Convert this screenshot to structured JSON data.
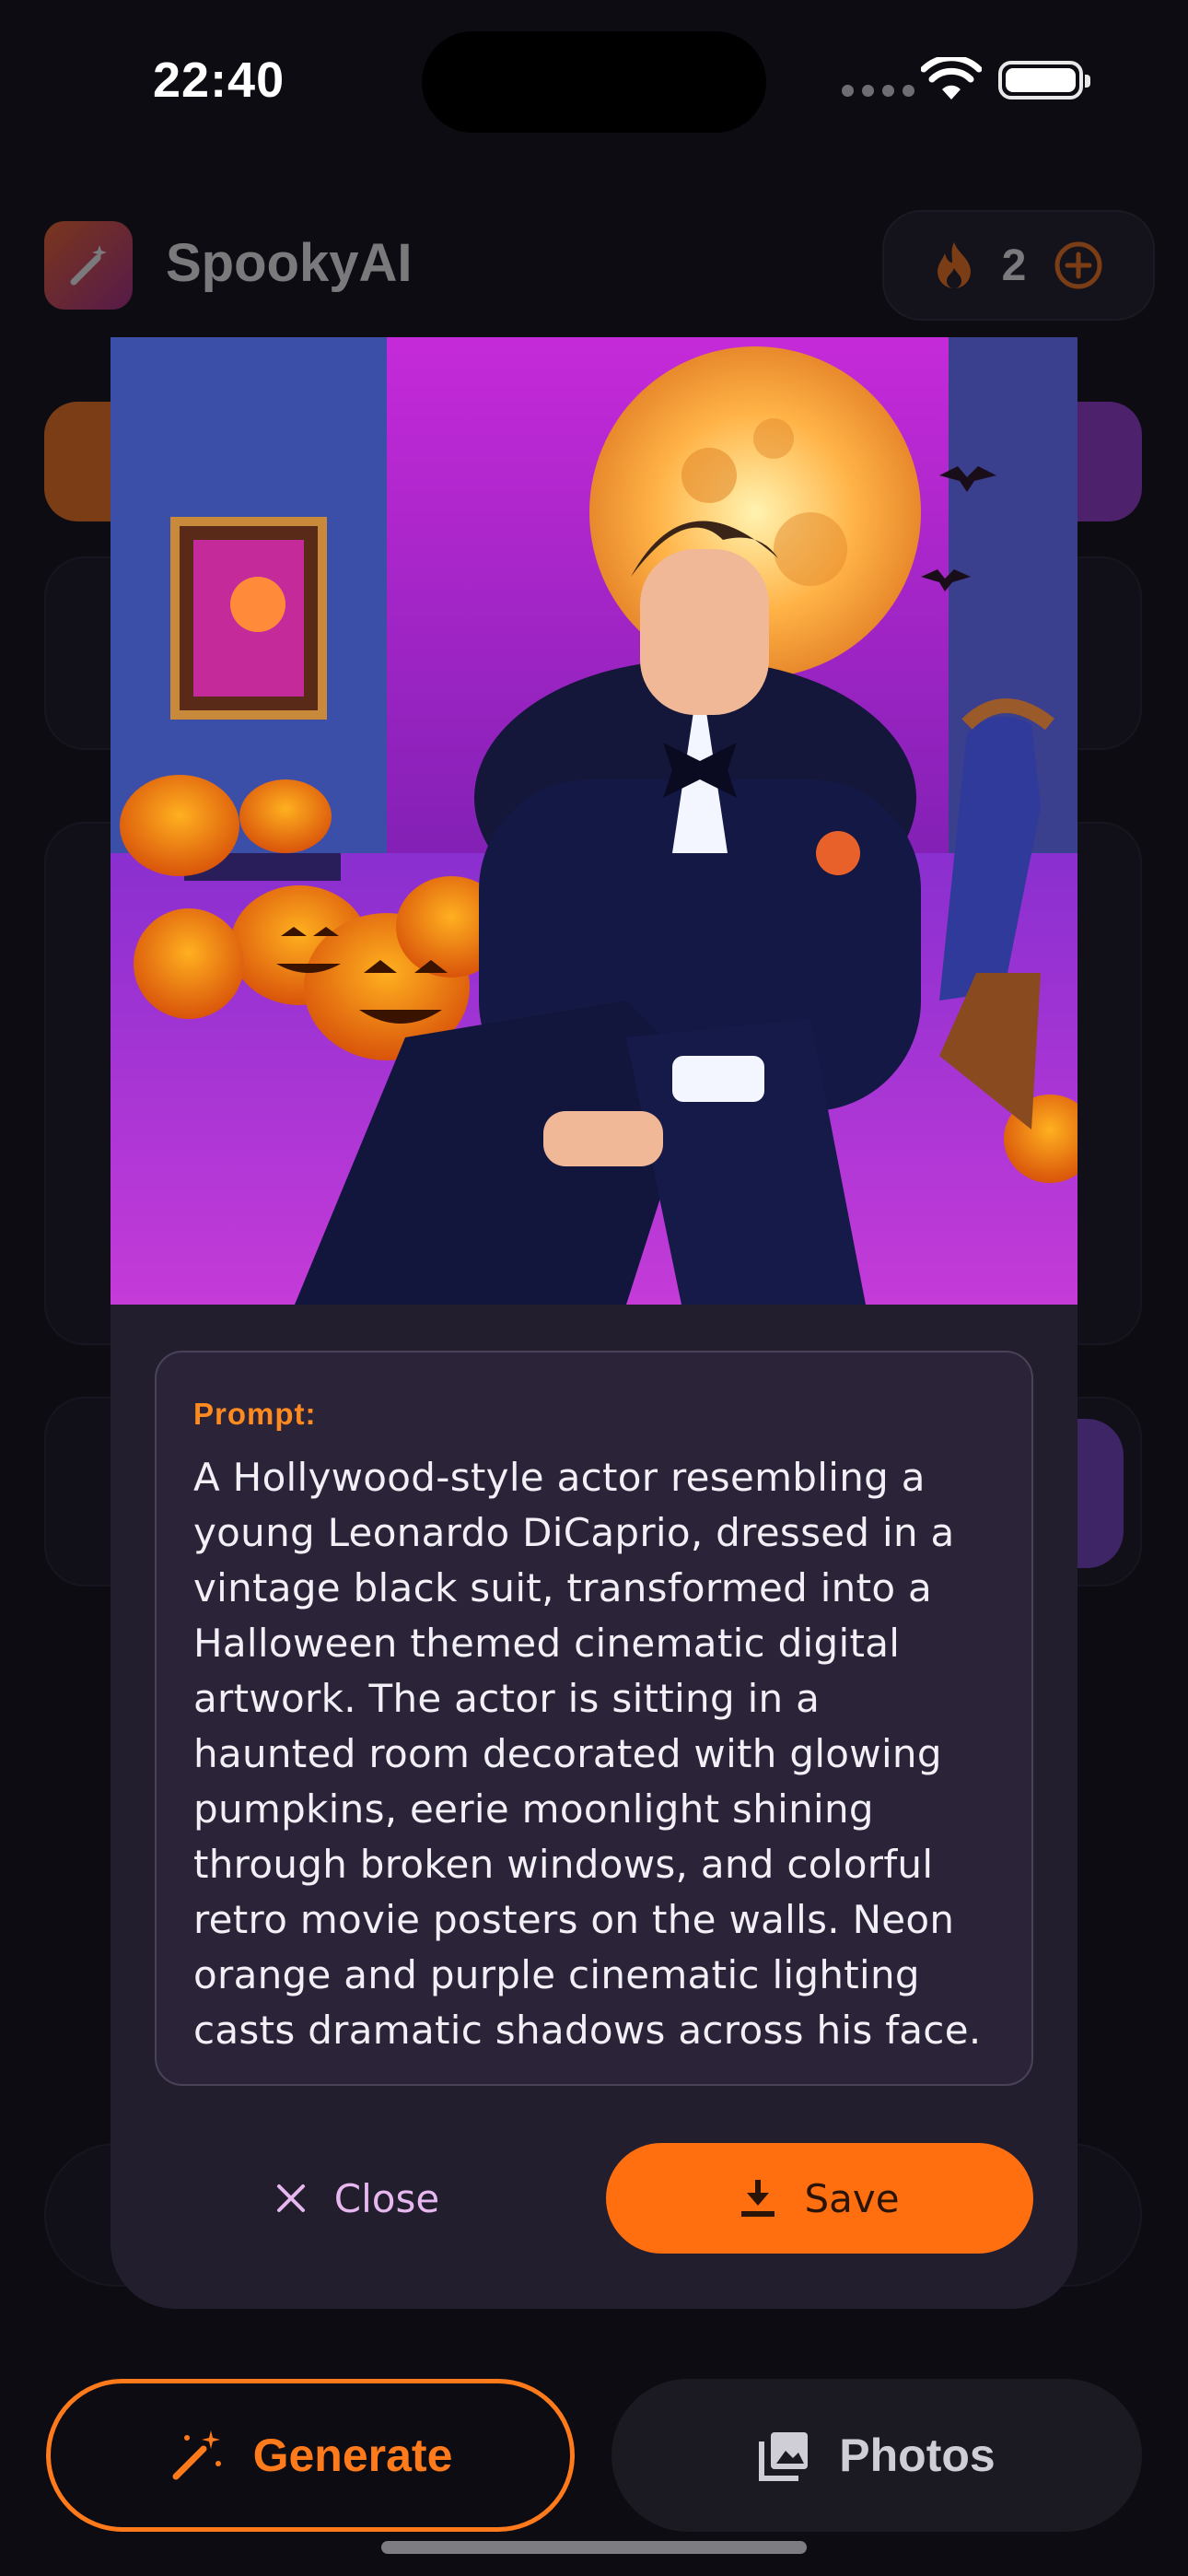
{
  "status_bar": {
    "time": "22:40"
  },
  "header": {
    "app_title": "SpookyAI",
    "credits": "2"
  },
  "modal": {
    "prompt_label": "Prompt:",
    "prompt_text": "A Hollywood-style actor resembling a young Leonardo DiCaprio, dressed in a vintage black suit, transformed into a Halloween themed cinematic digital artwork. The actor is sitting in a haunted room decorated with glowing pumpkins, eerie moonlight shining through broken windows, and colorful retro movie posters on the walls. Neon orange and purple cinematic lighting casts dramatic shadows across his face.",
    "close_label": "Close",
    "save_label": "Save"
  },
  "nav": {
    "generate_label": "Generate",
    "photos_label": "Photos"
  },
  "colors": {
    "accent_orange": "#ff6f0f",
    "accent_purple": "#9b3bd6",
    "modal_bg": "#221e2e"
  },
  "icons": [
    "magic-wand-icon",
    "flame-icon",
    "plus-circle-icon",
    "close-icon",
    "download-icon",
    "photos-icon",
    "wifi-icon",
    "battery-icon"
  ]
}
